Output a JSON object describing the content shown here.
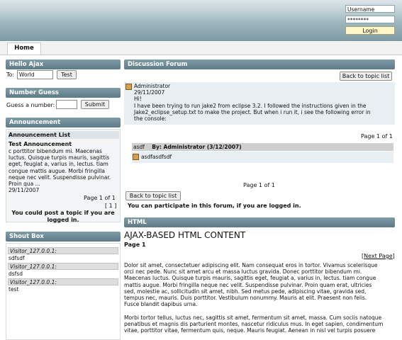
{
  "header": {
    "username_placeholder": "Username",
    "password_mask": "********",
    "login_label": "Login"
  },
  "nav": {
    "home_label": "Home"
  },
  "hello": {
    "title": "Hello Ajax",
    "to_label": "To:",
    "to_value": "World",
    "test_label": "Test"
  },
  "guess": {
    "title": "Number Guess",
    "label": "Guess a number:",
    "submit_label": "Submit"
  },
  "announcement": {
    "title": "Announcement",
    "list_header": "Announcement List",
    "item_title": "Test Announcement",
    "item_lines": [
      "c porttitor bibendum mi. Maecenas",
      "luctus. Quisque turpis mauris, sagittis",
      "eget, feugiat a, varius in, lectus. tiam",
      "congue mattis augue. Morbi fringilla",
      "neque nec velit. Suspendisse pulvinar.",
      "Proin qua ..."
    ],
    "item_date": "29/11/2007",
    "page_info": "Page 1 of 1",
    "page_link": "[ 1 ]",
    "notice_lines": [
      "You could post a topic if you are",
      "logged in."
    ]
  },
  "shoutbox": {
    "title": "Shout Box",
    "shouts": [
      {
        "user": "Visitor_127.0.0.1:",
        "text": "sdfsdf"
      },
      {
        "user": "Visitor_127.0.0.1:",
        "text": "dsfsd"
      },
      {
        "user": "Visitor_127.0.0.1:",
        "text": "test"
      }
    ]
  },
  "forum": {
    "title": "Discussion Forum",
    "back_label": "Back to topic list",
    "post": {
      "author": "Administrator",
      "date": "29/11/2007",
      "lines": [
        "Hi!",
        "I have been trying to run jake2 from eclipse 3.2. I followed the instructions given in the",
        "Jake2_eclipse_setup.txt to make the project. But when i run it, i see the following error in",
        "the console:"
      ]
    },
    "page_info_top": "Page 1 of 1",
    "reply_subject": "asdf",
    "reply_by": "By: Administrator (3/12/2007)",
    "reply_body": "asdfasdfsdf",
    "page_info_bottom": "Page 1 of 1",
    "back_label_bottom": "Back to topic list",
    "participate": "You can participate in this forum, if you are logged in."
  },
  "html": {
    "title": "HTML",
    "heading": "AJAX-BASED HTML CONTENT",
    "page_label": "Page 1",
    "next_page": "Next Page",
    "paragraph1": [
      "Dolor sit amet, consectetuer adipiscing elit. Nam consequat eros in tortor. Vivamus scelerisque",
      "orci nec pede. Nunc sit amet arcu et massa luctus gravida. Donec porttitor bibendum mi.",
      "Maecenas luctus. Quisque turpis mauris, sagittis eget, feugiat a, varius in, lectus. tiam congue",
      "mattis augue. Morbi fringilla neque nec velit. Suspendisse pulvinar. Proin quam erat, ultricies",
      "sed, molestie ac, sollicitudin sit amet, nibh. Sed metus pede, adipiscing vitae, gravida sed,",
      "tempus nec, mauris. Duis porttitor. Vestibulum nonummy. Mauris at elit. Praesent non felis.",
      "Fusce blandit dapibus urna."
    ],
    "paragraph2": [
      "Morbi tortor tellus, luctus nec, sagittis sit amet, fermentum sit amet, massa. Cum sociis natoque",
      "penatibus et magnis dis parturient montes, nascetur ridiculus mus. In eget sapien, condimentum",
      "vitae, porttitor vitae, fermentum quis, neque. Mauris feugiat. Aenean in nisl vel turpis posuere"
    ]
  }
}
